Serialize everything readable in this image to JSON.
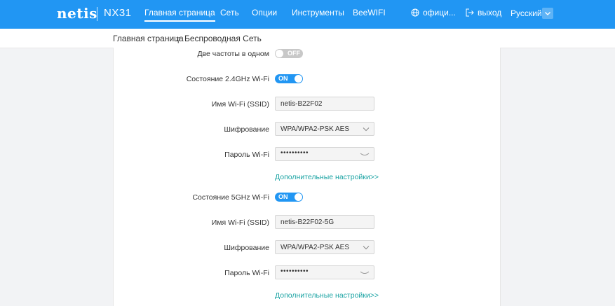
{
  "header": {
    "logo": "netis",
    "model": "NX31",
    "nav": [
      "Главная страница",
      "Сеть",
      "Опции",
      "Инструменты",
      "BeeWIFI"
    ],
    "official_label": "офици...",
    "logout_label": "выход",
    "language": "Русский",
    "bg_color": "#2196f3"
  },
  "breadcrumb": {
    "home": "Главная страница",
    "separator": "»",
    "current": "Беспроводная Сеть"
  },
  "dual_band": {
    "label": "Две частоты в одном",
    "state": "OFF"
  },
  "band24": {
    "status_label": "Состояние 2.4GHz Wi-Fi",
    "status": "ON",
    "ssid_label": "Имя Wi-Fi (SSID)",
    "ssid": "netis-B22F02",
    "enc_label": "Шифрование",
    "enc": "WPA/WPA2-PSK AES",
    "pw_label": "Пароль Wi-Fi",
    "pw": "••••••••••",
    "advanced": "Дополнительные настройки>>"
  },
  "band5": {
    "status_label": "Состояние 5GHz Wi-Fi",
    "status": "ON",
    "ssid_label": "Имя Wi-Fi (SSID)",
    "ssid": "netis-B22F02-5G",
    "enc_label": "Шифрование",
    "enc": "WPA/WPA2-PSK AES",
    "pw_label": "Пароль Wi-Fi",
    "pw": "••••••••••",
    "advanced": "Дополнительные настройки>>"
  }
}
